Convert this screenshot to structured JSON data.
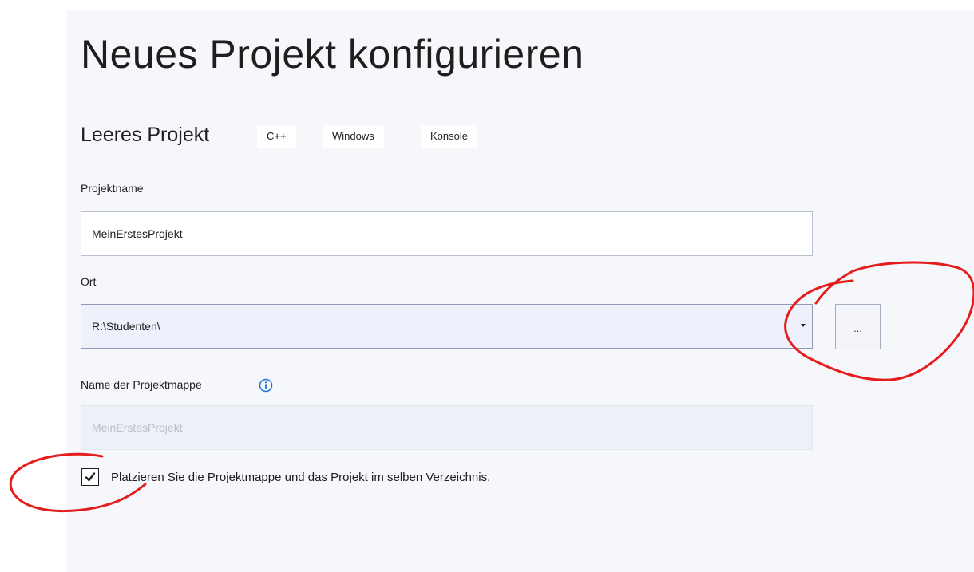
{
  "page": {
    "title": "Neues Projekt konfigurieren"
  },
  "template": {
    "name": "Leeres Projekt",
    "tags": [
      "C++",
      "Windows",
      "Konsole"
    ]
  },
  "project_name": {
    "label": "Projektname",
    "value": "MeinErstesProjekt"
  },
  "location": {
    "label": "Ort",
    "value": "R:\\Studenten\\",
    "browse_label": "..."
  },
  "solution_name": {
    "label": "Name der Projektmappe",
    "value": "MeinErstesProjekt",
    "info_icon": "info-icon"
  },
  "same_directory": {
    "label": "Platzieren Sie die Projektmappe und das Projekt im selben Verzeichnis.",
    "checked": true
  },
  "colors": {
    "panel_background": "#f6f7fb",
    "annotation_red": "#e41c1c",
    "info_blue": "#1a73d9"
  }
}
